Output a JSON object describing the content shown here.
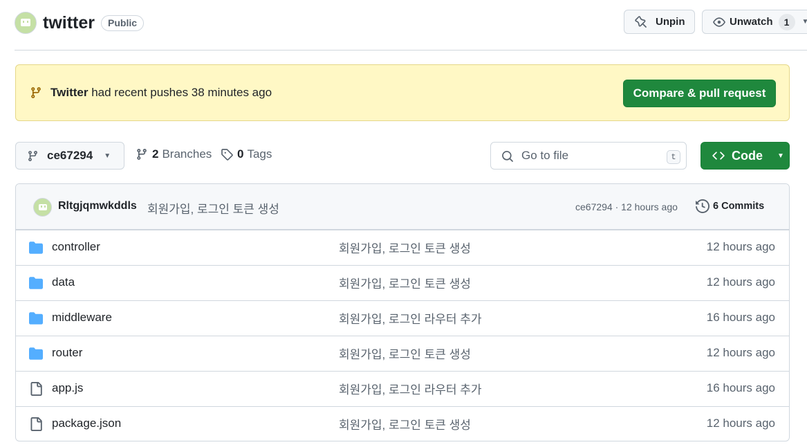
{
  "repo": {
    "name": "twitter",
    "visibility": "Public",
    "avatar_color": "#c5e0a5"
  },
  "header_actions": {
    "unpin_label": "Unpin",
    "unwatch_label": "Unwatch",
    "watch_count": "1"
  },
  "banner": {
    "branch": "Twitter",
    "text": " had recent pushes 38 minutes ago",
    "button_label": "Compare & pull request",
    "background": "#fff8c5"
  },
  "toolbar": {
    "current_ref": "ce67294",
    "branches_count": "2",
    "branches_label": "Branches",
    "tags_count": "0",
    "tags_label": "Tags",
    "search_placeholder": "Go to file",
    "search_shortcut": "t",
    "code_label": "Code",
    "accent": "#1f883d"
  },
  "latest_commit": {
    "author": "Rltgjqmwkddls",
    "message": "회원가입, 로그인 토큰 생성",
    "meta": "ce67294 · 12 hours ago",
    "commits_label": "6 Commits"
  },
  "files": [
    {
      "type": "folder",
      "icon": "folder-icon",
      "name": "controller",
      "message": "회원가입, 로그인 토큰 생성",
      "time": "12 hours ago"
    },
    {
      "type": "folder",
      "icon": "folder-icon",
      "name": "data",
      "message": "회원가입, 로그인 토큰 생성",
      "time": "12 hours ago"
    },
    {
      "type": "folder",
      "icon": "folder-icon",
      "name": "middleware",
      "message": "회원가입, 로그인 라우터 추가",
      "time": "16 hours ago"
    },
    {
      "type": "folder",
      "icon": "folder-icon",
      "name": "router",
      "message": "회원가입, 로그인 토큰 생성",
      "time": "12 hours ago"
    },
    {
      "type": "file",
      "icon": "file-icon",
      "name": "app.js",
      "message": "회원가입, 로그인 라우터 추가",
      "time": "16 hours ago"
    },
    {
      "type": "file",
      "icon": "file-icon",
      "name": "package.json",
      "message": "회원가입, 로그인 토큰 생성",
      "time": "12 hours ago"
    }
  ]
}
